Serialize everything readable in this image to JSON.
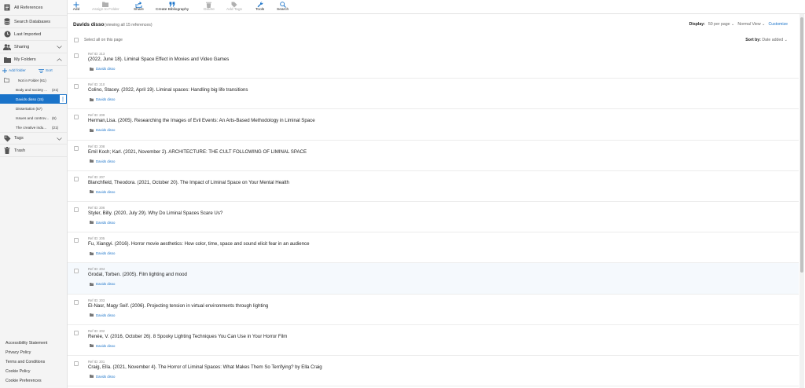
{
  "sidebar": {
    "all_references": "All References",
    "search_databases": "Search Databases",
    "last_imported": "Last Imported",
    "sharing": "Sharing",
    "my_folders": "My Folders",
    "add_folder": "Add folder",
    "sort": "Sort",
    "not_in_folder": "Not in Folder (61)",
    "folders": [
      {
        "name": "Body and society ...",
        "count": "(21)"
      },
      {
        "name": "Davids disso (15)",
        "count": ""
      },
      {
        "name": "Dissertation (57)",
        "count": ""
      },
      {
        "name": "Issues and controv...",
        "count": "(6)"
      },
      {
        "name": "The creative indu...",
        "count": "(21)"
      }
    ],
    "tags": "Tags",
    "trash": "Trash",
    "footer": {
      "accessibility": "Accessibility Statement",
      "privacy": "Privacy Policy",
      "terms": "Terms and Conditions",
      "cookie_policy": "Cookie Policy",
      "cookie_prefs": "Cookie Preferences"
    }
  },
  "toolbar": {
    "add": "Add",
    "assign": "Assign to Folder",
    "share": "Share",
    "create_bib": "Create Bibliography",
    "delete": "Delete",
    "add_tags": "Add Tags",
    "tools": "Tools",
    "search": "Search"
  },
  "main": {
    "folder_title": "Davids disso",
    "viewing": "(viewing all 15 references)",
    "display_label": "Display:",
    "per_page": "50 per page",
    "view_mode": "Normal View",
    "customize": "Customize",
    "select_all": "Select all on this page",
    "sort_label": "Sort by:",
    "sort_value": "Date added",
    "references": [
      {
        "id": "Ref ID: 213",
        "text": "(2022, June 18). Liminal Space Effect in Movies and Video Games",
        "folder": "Davids disso"
      },
      {
        "id": "Ref ID: 210",
        "text": "Colino, Stacey. (2022, April 19). Liminal spaces: Handling big life transitions",
        "folder": "Davids disso"
      },
      {
        "id": "Ref ID: 209",
        "text": "Herman,Lisa. (2005). Researching the Images of Evil Events: An Arts-Based Methodology in Liminal Space",
        "folder": "Davids disso"
      },
      {
        "id": "Ref ID: 208",
        "text": "Emil Koch; Karl. (2021, November 2). ARCHITECTURE: THE CULT FOLLOWING OF LIMINAL SPACE",
        "folder": "Davids disso"
      },
      {
        "id": "Ref ID: 207",
        "text": "Blanchfield, Theodora. (2021, October 20). The Impact of Liminal Space on Your Mental Health",
        "folder": "Davids disso"
      },
      {
        "id": "Ref ID: 206",
        "text": "Styler, Billy. (2020, July 29). Why Do Liminal Spaces Scare Us?",
        "folder": "Davids disso"
      },
      {
        "id": "Ref ID: 205",
        "text": "Fu, Xiangyi. (2016). Horror movie aesthetics: How color, time, space and sound elicit fear in an audience",
        "folder": "Davids disso"
      },
      {
        "id": "Ref ID: 204",
        "text": "Grodal, Torben. (2005). Film lighting and mood",
        "folder": "Davids disso"
      },
      {
        "id": "Ref ID: 203",
        "text": "El-Nasr, Magy Seif. (2006). Projecting tension in virtual environments through lighting",
        "folder": "Davids disso"
      },
      {
        "id": "Ref ID: 202",
        "text": "Renée, V. (2016, October 26). 8 Spooky Lighting Techniques You Can Use in Your Horror Film",
        "folder": "Davids disso"
      },
      {
        "id": "Ref ID: 201",
        "text": "Craig, Ella. (2021, November 4). The Horror of Liminal Spaces: What Makes Them So Terrifying? by Ella Craig",
        "folder": "Davids disso"
      }
    ]
  },
  "colors": {
    "accent": "#1a73c9",
    "sidebar_bg": "#f4f4f4",
    "highlight_row": "#f5f9fd"
  }
}
